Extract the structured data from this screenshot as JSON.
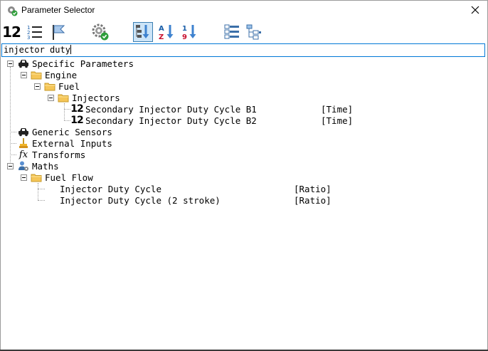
{
  "window": {
    "title": "Parameter Selector"
  },
  "toolbar": {
    "buttons": [
      {
        "icon": "numeric-view-icon",
        "text": "12",
        "active": false
      },
      {
        "icon": "numbered-list-icon",
        "text": "",
        "active": false
      },
      {
        "icon": "flag-icon",
        "text": "",
        "active": false
      },
      {
        "icon": "settings-check-icon",
        "text": "",
        "active": false
      },
      {
        "icon": "sort-tree-icon",
        "text": "",
        "active": true
      },
      {
        "icon": "sort-alpha-icon",
        "text": "",
        "active": false
      },
      {
        "icon": "sort-numeric-icon",
        "text": "",
        "active": false
      },
      {
        "icon": "expand-all-icon",
        "text": "",
        "active": false
      },
      {
        "icon": "collapse-tree-icon",
        "text": "",
        "active": false
      }
    ]
  },
  "search": {
    "value": "injector duty"
  },
  "tree": {
    "specific": {
      "label": "Specific Parameters",
      "engine": "Engine",
      "fuel": "Fuel",
      "injectors": "Injectors",
      "b1": {
        "label": "Secondary Injector Duty Cycle B1",
        "unit": "[Time]",
        "icon_text": "12"
      },
      "b2": {
        "label": "Secondary Injector Duty Cycle B2",
        "unit": "[Time]",
        "icon_text": "12"
      }
    },
    "generic": "Generic Sensors",
    "external": "External Inputs",
    "transforms": {
      "label": "Transforms",
      "icon_text": "fx"
    },
    "maths": {
      "label": "Maths",
      "fuel_flow": "Fuel Flow",
      "idc": {
        "label": "Injector Duty Cycle",
        "unit": "[Ratio]"
      },
      "idc2": {
        "label": "Injector Duty Cycle (2 stroke)",
        "unit": "[Ratio]"
      }
    }
  }
}
